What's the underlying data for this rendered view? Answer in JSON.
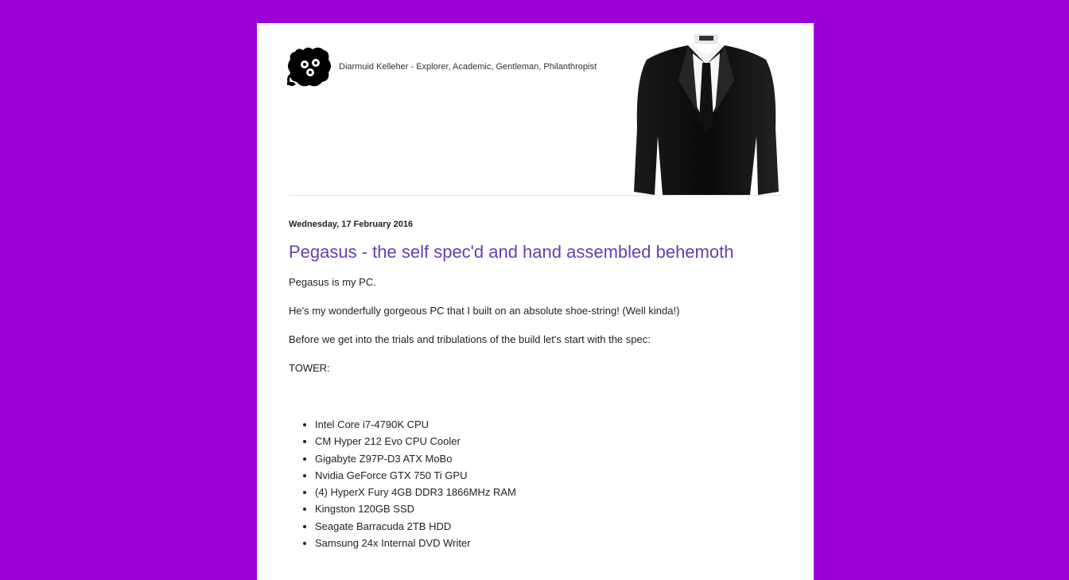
{
  "header": {
    "tagline": "Diarmuid Kelleher - Explorer, Academic, Gentleman, Philanthropist",
    "logo_icon": "gears-mascot-icon",
    "banner_image": "suit-figure-image"
  },
  "post": {
    "date": "Wednesday, 17 February 2016",
    "title": "Pegasus - the self spec'd and hand assembled behemoth",
    "paragraphs": [
      "Pegasus is my PC.",
      "He's my wonderfully gorgeous PC that I built on an absolute shoe-string! (Well kinda!)",
      "Before we get into the trials and tribulations of the build let's start with the spec:",
      "TOWER:"
    ],
    "spec_items": [
      "Intel Core i7-4790K CPU",
      "CM Hyper 212 Evo CPU Cooler",
      "Gigabyte Z97P-D3 ATX MoBo",
      "Nvidia GeForce GTX 750 Ti GPU",
      "(4) HyperX Fury 4GB DDR3 1866MHz RAM",
      "Kingston 120GB SSD",
      "Seagate Barracuda 2TB HDD",
      "Samsung 24x Internal DVD Writer"
    ]
  },
  "colors": {
    "background": "#9c00d6",
    "title": "#6a3bb4",
    "text": "#222222"
  }
}
